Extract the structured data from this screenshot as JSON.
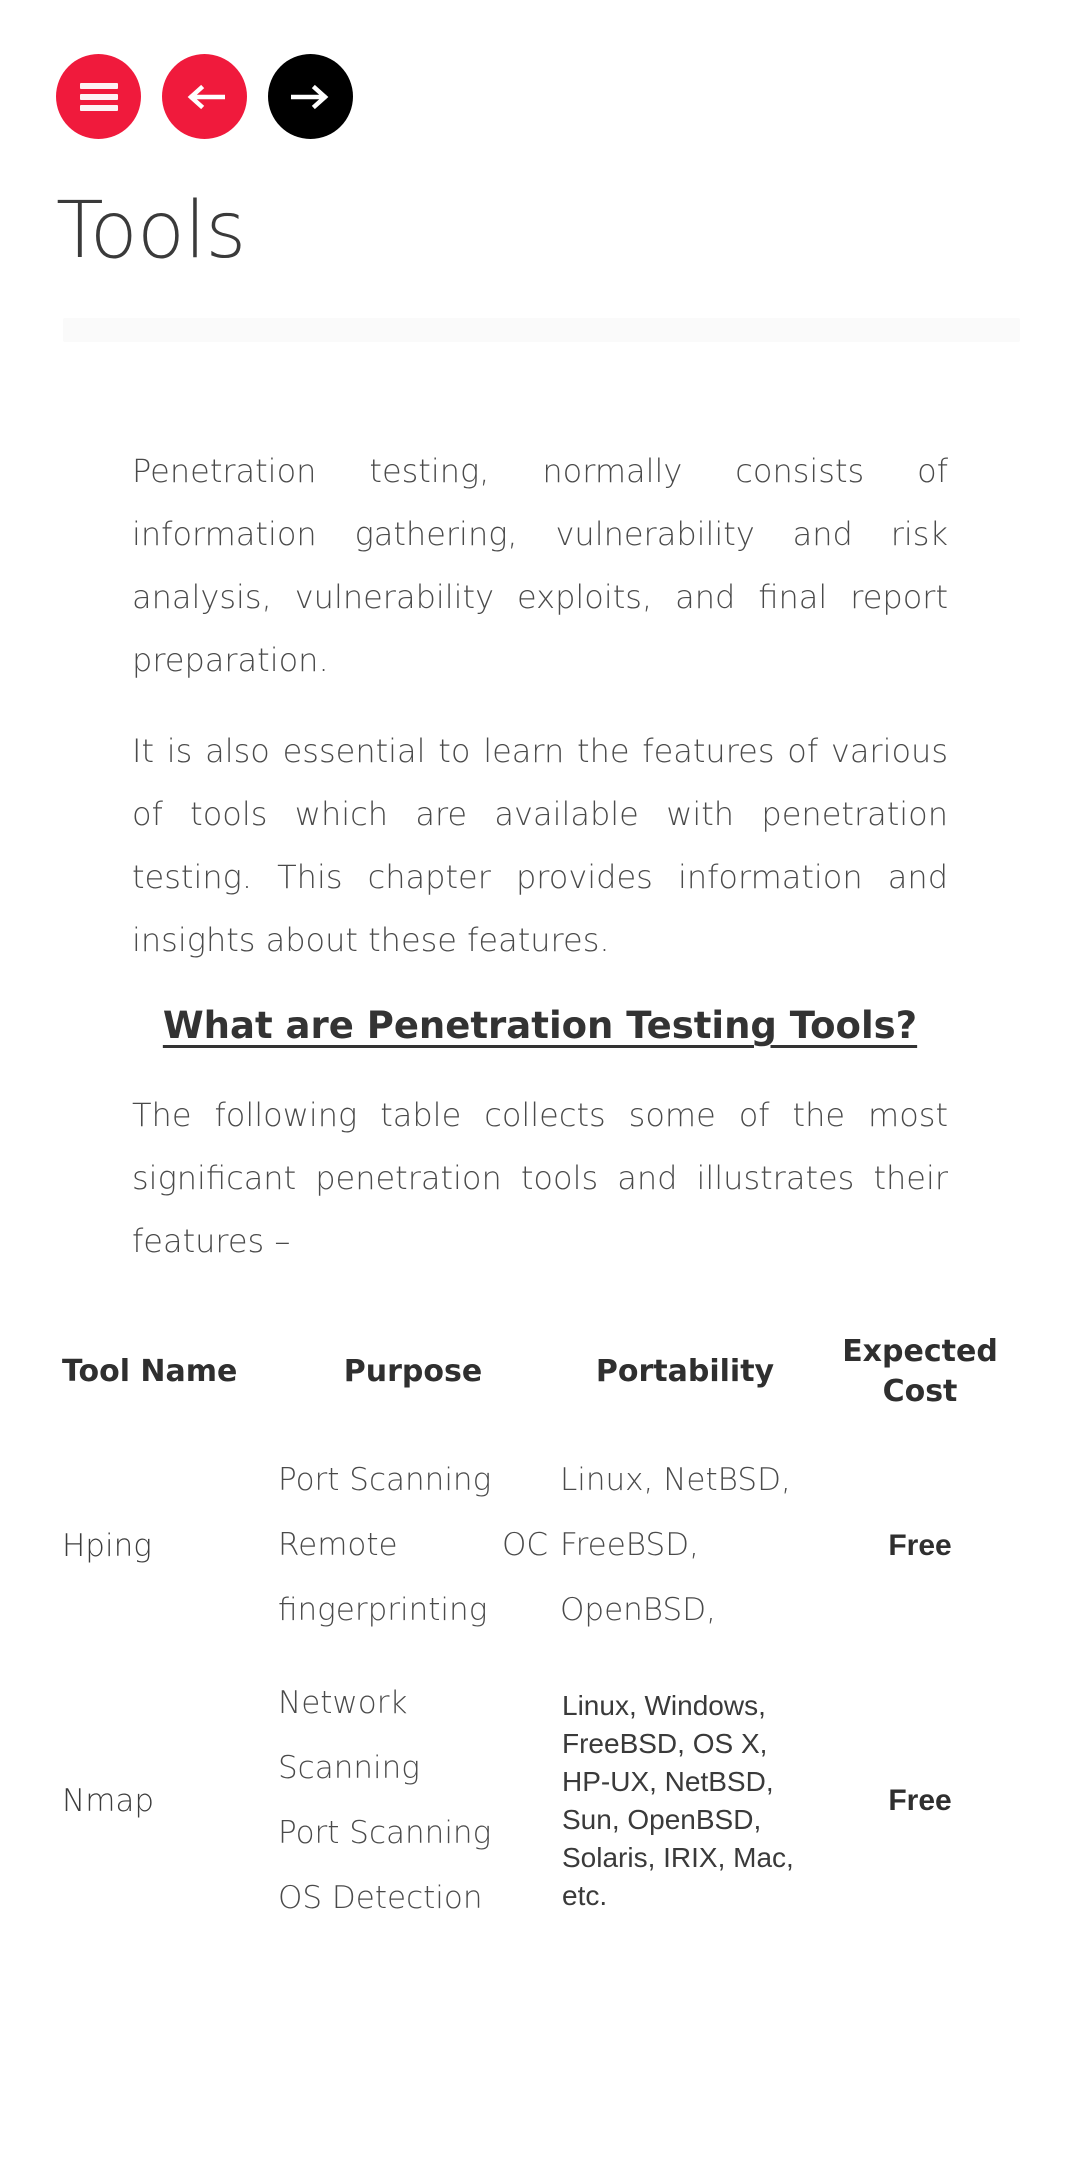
{
  "theme": {
    "accent_red": "#f01a3c",
    "black": "#000000",
    "text": "#4a4a4a",
    "divider": "#fafafa"
  },
  "nav": {
    "menu_button": {
      "icon": "hamburger-menu-icon",
      "label": ""
    },
    "prev_button": {
      "icon": "arrow-left-icon",
      "label": ""
    },
    "next_button": {
      "icon": "arrow-right-icon",
      "label": ""
    }
  },
  "header": {
    "title": "Tools"
  },
  "content": {
    "paragraph_1": "Penetration testing, normally consists of information gathering, vulnerability and risk analysis, vulnerability exploits, and final report preparation.",
    "paragraph_2": "It is also essential to learn the features of various of tools which are available with penetration testing. This chapter provides information and insights about these features.",
    "heading": "What are Penetration Testing Tools?",
    "paragraph_3": "The following table collects some of the most significant penetration tools and illustrates their features –"
  },
  "table": {
    "headers": [
      "Tool Name",
      "Purpose",
      "Portability",
      "Expected Cost"
    ],
    "rows": [
      {
        "tool_name": "Hping",
        "purpose_lines": [
          "Port Scanning",
          "Remote OC fingerprinting"
        ],
        "portability_lines": [
          "Linux, NetBSD,",
          "FreeBSD,",
          "OpenBSD,"
        ],
        "cost": "Free"
      },
      {
        "tool_name": "Nmap",
        "purpose_lines": [
          "Network Scanning",
          "Port Scanning",
          "OS Detection"
        ],
        "portability": "Linux, Windows, FreeBSD, OS X, HP-UX, NetBSD, Sun, OpenBSD, Solaris, IRIX, Mac, etc.",
        "cost": "Free"
      }
    ]
  }
}
